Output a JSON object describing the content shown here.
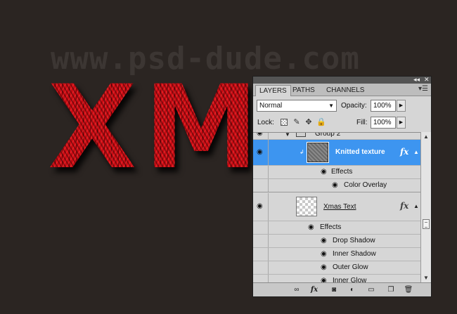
{
  "canvas": {
    "watermark": "www.psd-dude.com",
    "knit_text": "XMAS"
  },
  "panel": {
    "tabs": [
      "LAYERS",
      "PATHS",
      "CHANNELS"
    ],
    "active_tab": "LAYERS",
    "blend_mode": "Normal",
    "opacity_label": "Opacity:",
    "opacity_value": "100%",
    "lock_label": "Lock:",
    "fill_label": "Fill:",
    "fill_value": "100%",
    "layers": {
      "group_name": "Group 2",
      "knitted": "Knitted texture",
      "knitted_effects_label": "Effects",
      "knitted_effects": [
        "Color Overlay"
      ],
      "xmas": "Xmas Text",
      "xmas_effects_label": "Effects",
      "xmas_effects": [
        "Drop Shadow",
        "Inner Shadow",
        "Outer Glow",
        "Inner Glow"
      ]
    },
    "fx_glyph": "fx",
    "icons": {
      "collapse": "double-arrow-left-icon",
      "close": "close-icon",
      "menu": "panel-menu-icon",
      "eye": "eye-icon",
      "link": "link-layers-icon",
      "add_style": "fx-add-style-icon",
      "mask": "layer-mask-icon",
      "adjustment": "adjustment-layer-icon",
      "group": "new-group-icon",
      "new_layer": "new-layer-icon",
      "delete": "trash-icon"
    },
    "colors": {
      "selection": "#3d95f0",
      "panel_bg": "#d6d6d6",
      "canvas_bg": "#2b2522",
      "knit_red": "#c80a12"
    }
  }
}
